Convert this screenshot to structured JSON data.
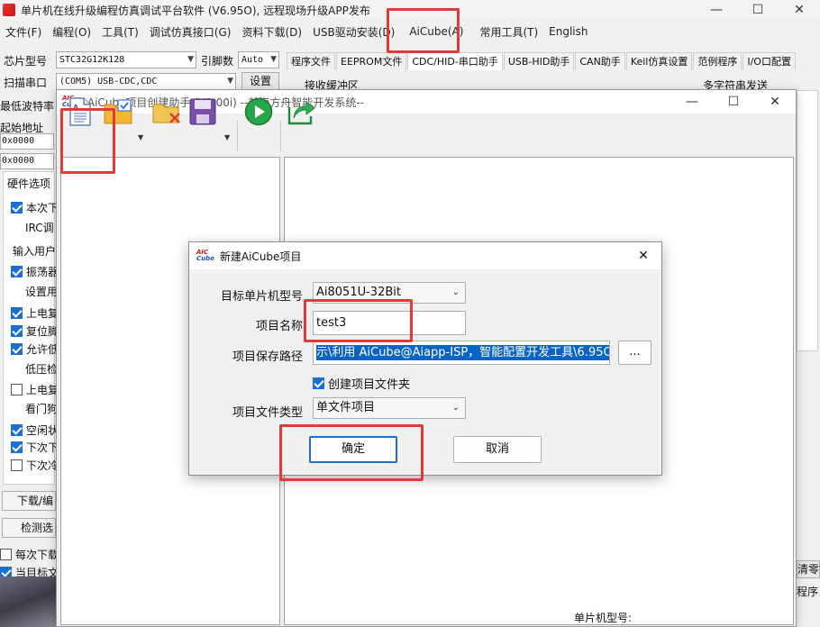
{
  "main_window": {
    "title": "单片机在线升级编程仿真调试平台软件 (V6.95O), 远程现场升级APP发布",
    "controls": {
      "minimize": "—",
      "maximize": "☐",
      "close": "✕"
    }
  },
  "menu": [
    "文件(F)",
    "编程(O)",
    "工具(T)",
    "调试仿真接口(G)",
    "资料下载(D)",
    "USB驱动安装(D)",
    "AiCube(A)",
    "常用工具(T)",
    "English"
  ],
  "chip_row": {
    "chip_label": "芯片型号",
    "chip_value": "STC32G12K128",
    "pin_label": "引脚数",
    "pin_value": "Auto",
    "scan_label": "扫描串口",
    "port_value": "(COM5) USB-CDC,CDC",
    "settings_label": "设置"
  },
  "tabs": [
    "程序文件",
    "EEPROM文件",
    "CDC/HID-串口助手",
    "USB-HID助手",
    "CAN助手",
    "Keil仿真设置",
    "范例程序",
    "I/O口配置"
  ],
  "right_bg": {
    "recv_label": "接收缓冲区",
    "multi_send": "多字符串发送",
    "clear": "清零",
    "prog": "程序"
  },
  "left_panel": {
    "baud_label": "最低波特率",
    "start_addr_label": "起始地址",
    "addr1": "0x0000",
    "addr2": "0x0000",
    "hw_group_label": "硬件选项",
    "options": [
      {
        "text": "本次下",
        "checked": true
      },
      {
        "text": "IRC调",
        "checked": null
      },
      {
        "text": "输入用户",
        "checked": null
      },
      {
        "text": "振荡器",
        "checked": true
      },
      {
        "text": "设置用",
        "checked": null
      },
      {
        "text": "上电复",
        "checked": true
      },
      {
        "text": "复位脚",
        "checked": true
      },
      {
        "text": "允许低",
        "checked": true
      },
      {
        "text": "低压检",
        "checked": null
      },
      {
        "text": "上电复",
        "checked": false
      },
      {
        "text": "看门狗",
        "checked": null
      },
      {
        "text": "空闲状",
        "checked": true
      },
      {
        "text": "下次下",
        "checked": true
      },
      {
        "text": "下次冷",
        "checked": false
      }
    ],
    "download_btn": "下载/编",
    "detect_btn": "检测选",
    "every_download": "每次下载",
    "when_target": "当目标文"
  },
  "helper_window": {
    "title": "AiCube项目创建助手 (V1.00i) --前海方舟智能开发系统--",
    "logo_top": "AIC",
    "logo_bottom": "Cube",
    "controls": {
      "minimize": "—",
      "maximize": "☐",
      "close": "✕"
    },
    "status_text": "单片机型号:"
  },
  "dialog": {
    "title": "新建AiCube项目",
    "fields": {
      "target_mcu_label": "目标单片机型号",
      "target_mcu_value": "Ai8051U-32Bit",
      "project_name_label": "项目名称",
      "project_name_value": "test3",
      "save_path_label": "项目保存路径",
      "save_path_value": "示\\利用 AiCube@Aiapp-ISP，智能配置开发工具\\6.95O",
      "browse_label": "...",
      "create_folder_label": "创建项目文件夹",
      "create_folder_checked": true,
      "file_type_label": "项目文件类型",
      "file_type_value": "单文件项目"
    },
    "ok_label": "确定",
    "cancel_label": "取消",
    "close": "✕"
  },
  "colors": {
    "highlight": "#e23a3a",
    "accent": "#1a6fd0",
    "selection": "#0a64c8"
  }
}
